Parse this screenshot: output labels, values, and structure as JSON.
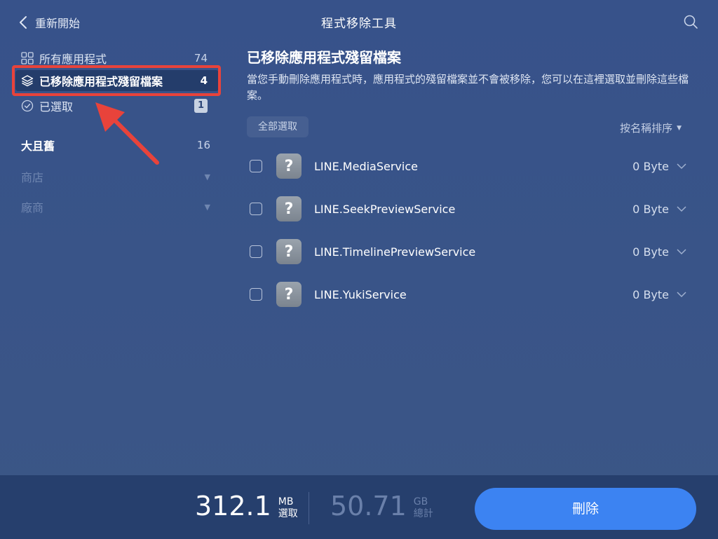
{
  "header": {
    "back_label": "重新開始",
    "title": "程式移除工具"
  },
  "sidebar": {
    "items": [
      {
        "label": "所有應用程式",
        "count": "74",
        "icon": "grid-icon"
      },
      {
        "label": "已移除應用程式殘留檔案",
        "count": "4",
        "icon": "layers-icon"
      },
      {
        "label": "已選取",
        "count": "1",
        "icon": "check-circle-icon"
      }
    ],
    "sections": [
      {
        "label": "大且舊",
        "count": "16"
      },
      {
        "label": "商店"
      },
      {
        "label": "廠商"
      }
    ]
  },
  "main": {
    "title": "已移除應用程式殘留檔案",
    "description": "當您手動刪除應用程式時，應用程式的殘留檔案並不會被移除，您可以在這裡選取並刪除這些檔案。",
    "select_all": "全部選取",
    "sort_label": "按名稱排序",
    "rows": [
      {
        "icon": "?",
        "name": "LINE.MediaService",
        "size": "0 Byte"
      },
      {
        "icon": "?",
        "name": "LINE.SeekPreviewService",
        "size": "0 Byte"
      },
      {
        "icon": "?",
        "name": "LINE.TimelinePreviewService",
        "size": "0 Byte"
      },
      {
        "icon": "?",
        "name": "LINE.YukiService",
        "size": "0 Byte"
      }
    ]
  },
  "footer": {
    "selected_value": "312.1",
    "selected_unit": "MB",
    "selected_label": "選取",
    "total_value": "50.71",
    "total_unit": "GB",
    "total_label": "總計",
    "delete_label": "刪除"
  },
  "colors": {
    "background": "#3a5587",
    "footer": "#263f6d",
    "accent": "#3c83f2",
    "highlight": "#e8433b"
  }
}
